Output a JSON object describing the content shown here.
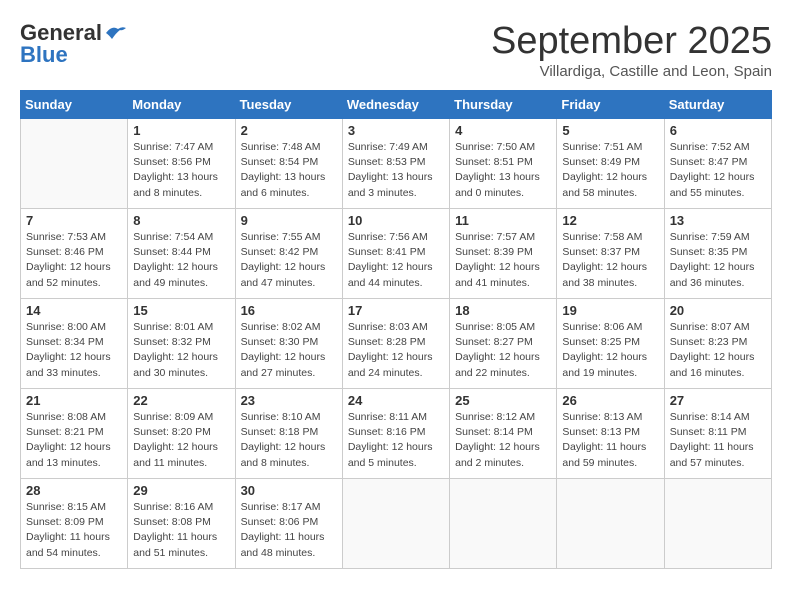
{
  "logo": {
    "line1": "General",
    "line2": "Blue"
  },
  "title": "September 2025",
  "subtitle": "Villardiga, Castille and Leon, Spain",
  "days_of_week": [
    "Sunday",
    "Monday",
    "Tuesday",
    "Wednesday",
    "Thursday",
    "Friday",
    "Saturday"
  ],
  "weeks": [
    [
      {
        "day": "",
        "info": ""
      },
      {
        "day": "1",
        "info": "Sunrise: 7:47 AM\nSunset: 8:56 PM\nDaylight: 13 hours\nand 8 minutes."
      },
      {
        "day": "2",
        "info": "Sunrise: 7:48 AM\nSunset: 8:54 PM\nDaylight: 13 hours\nand 6 minutes."
      },
      {
        "day": "3",
        "info": "Sunrise: 7:49 AM\nSunset: 8:53 PM\nDaylight: 13 hours\nand 3 minutes."
      },
      {
        "day": "4",
        "info": "Sunrise: 7:50 AM\nSunset: 8:51 PM\nDaylight: 13 hours\nand 0 minutes."
      },
      {
        "day": "5",
        "info": "Sunrise: 7:51 AM\nSunset: 8:49 PM\nDaylight: 12 hours\nand 58 minutes."
      },
      {
        "day": "6",
        "info": "Sunrise: 7:52 AM\nSunset: 8:47 PM\nDaylight: 12 hours\nand 55 minutes."
      }
    ],
    [
      {
        "day": "7",
        "info": "Sunrise: 7:53 AM\nSunset: 8:46 PM\nDaylight: 12 hours\nand 52 minutes."
      },
      {
        "day": "8",
        "info": "Sunrise: 7:54 AM\nSunset: 8:44 PM\nDaylight: 12 hours\nand 49 minutes."
      },
      {
        "day": "9",
        "info": "Sunrise: 7:55 AM\nSunset: 8:42 PM\nDaylight: 12 hours\nand 47 minutes."
      },
      {
        "day": "10",
        "info": "Sunrise: 7:56 AM\nSunset: 8:41 PM\nDaylight: 12 hours\nand 44 minutes."
      },
      {
        "day": "11",
        "info": "Sunrise: 7:57 AM\nSunset: 8:39 PM\nDaylight: 12 hours\nand 41 minutes."
      },
      {
        "day": "12",
        "info": "Sunrise: 7:58 AM\nSunset: 8:37 PM\nDaylight: 12 hours\nand 38 minutes."
      },
      {
        "day": "13",
        "info": "Sunrise: 7:59 AM\nSunset: 8:35 PM\nDaylight: 12 hours\nand 36 minutes."
      }
    ],
    [
      {
        "day": "14",
        "info": "Sunrise: 8:00 AM\nSunset: 8:34 PM\nDaylight: 12 hours\nand 33 minutes."
      },
      {
        "day": "15",
        "info": "Sunrise: 8:01 AM\nSunset: 8:32 PM\nDaylight: 12 hours\nand 30 minutes."
      },
      {
        "day": "16",
        "info": "Sunrise: 8:02 AM\nSunset: 8:30 PM\nDaylight: 12 hours\nand 27 minutes."
      },
      {
        "day": "17",
        "info": "Sunrise: 8:03 AM\nSunset: 8:28 PM\nDaylight: 12 hours\nand 24 minutes."
      },
      {
        "day": "18",
        "info": "Sunrise: 8:05 AM\nSunset: 8:27 PM\nDaylight: 12 hours\nand 22 minutes."
      },
      {
        "day": "19",
        "info": "Sunrise: 8:06 AM\nSunset: 8:25 PM\nDaylight: 12 hours\nand 19 minutes."
      },
      {
        "day": "20",
        "info": "Sunrise: 8:07 AM\nSunset: 8:23 PM\nDaylight: 12 hours\nand 16 minutes."
      }
    ],
    [
      {
        "day": "21",
        "info": "Sunrise: 8:08 AM\nSunset: 8:21 PM\nDaylight: 12 hours\nand 13 minutes."
      },
      {
        "day": "22",
        "info": "Sunrise: 8:09 AM\nSunset: 8:20 PM\nDaylight: 12 hours\nand 11 minutes."
      },
      {
        "day": "23",
        "info": "Sunrise: 8:10 AM\nSunset: 8:18 PM\nDaylight: 12 hours\nand 8 minutes."
      },
      {
        "day": "24",
        "info": "Sunrise: 8:11 AM\nSunset: 8:16 PM\nDaylight: 12 hours\nand 5 minutes."
      },
      {
        "day": "25",
        "info": "Sunrise: 8:12 AM\nSunset: 8:14 PM\nDaylight: 12 hours\nand 2 minutes."
      },
      {
        "day": "26",
        "info": "Sunrise: 8:13 AM\nSunset: 8:13 PM\nDaylight: 11 hours\nand 59 minutes."
      },
      {
        "day": "27",
        "info": "Sunrise: 8:14 AM\nSunset: 8:11 PM\nDaylight: 11 hours\nand 57 minutes."
      }
    ],
    [
      {
        "day": "28",
        "info": "Sunrise: 8:15 AM\nSunset: 8:09 PM\nDaylight: 11 hours\nand 54 minutes."
      },
      {
        "day": "29",
        "info": "Sunrise: 8:16 AM\nSunset: 8:08 PM\nDaylight: 11 hours\nand 51 minutes."
      },
      {
        "day": "30",
        "info": "Sunrise: 8:17 AM\nSunset: 8:06 PM\nDaylight: 11 hours\nand 48 minutes."
      },
      {
        "day": "",
        "info": ""
      },
      {
        "day": "",
        "info": ""
      },
      {
        "day": "",
        "info": ""
      },
      {
        "day": "",
        "info": ""
      }
    ]
  ]
}
